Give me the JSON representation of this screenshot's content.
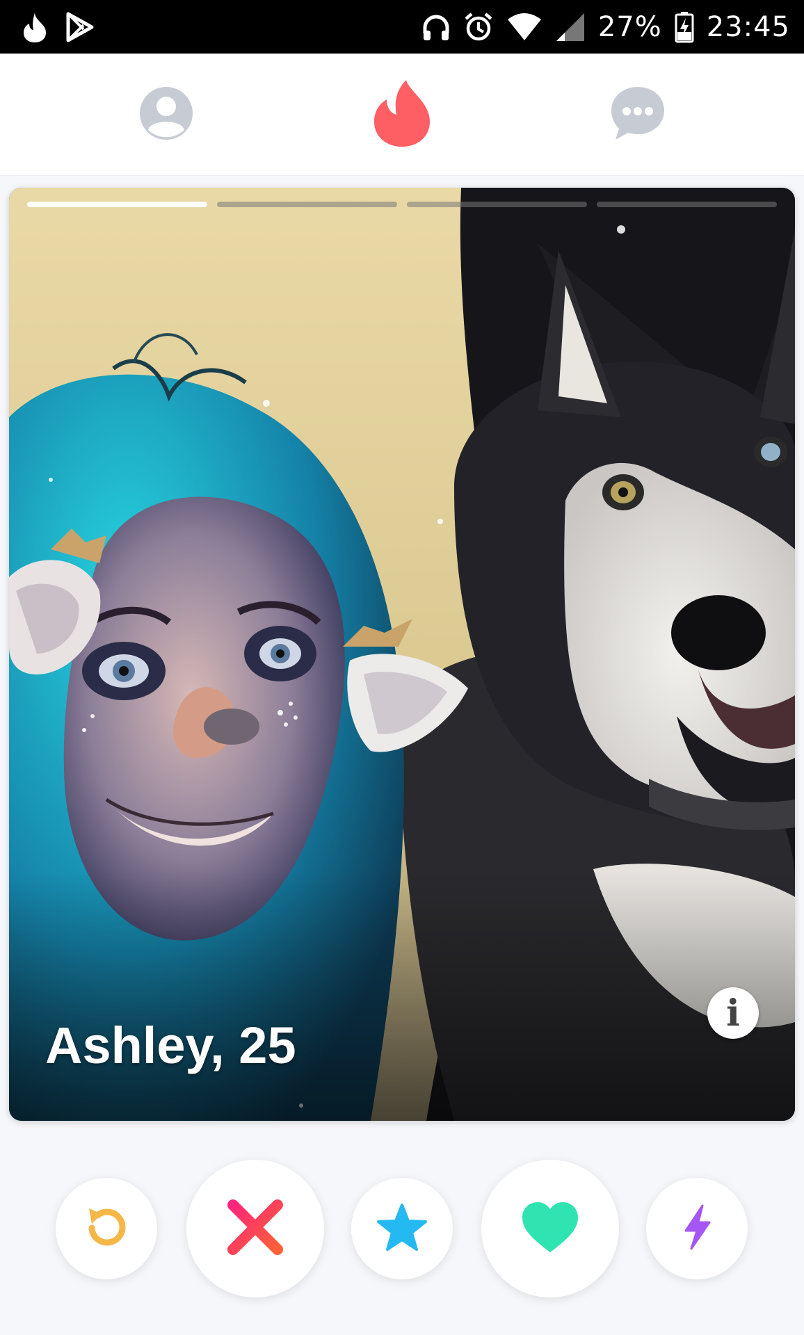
{
  "status_bar": {
    "left_icons": [
      "tinder-flame-icon",
      "play-store-icon"
    ],
    "right_icons": [
      "headphones-icon",
      "alarm-icon",
      "wifi-icon",
      "signal-icon",
      "battery-charging-icon"
    ],
    "battery": "27%",
    "time": "23:45"
  },
  "nav": {
    "items": [
      {
        "icon": "profile-icon",
        "color": "#c7cbd3"
      },
      {
        "icon": "flame-icon",
        "color": "#fe5f64",
        "active": true
      },
      {
        "icon": "messages-icon",
        "color": "#c7cbd3"
      }
    ]
  },
  "card": {
    "name_age": "Ashley, 25",
    "photo_count": 4,
    "current_photo": 1
  },
  "actions": [
    {
      "name": "rewind",
      "icon": "rewind-icon",
      "color": "#f5b748"
    },
    {
      "name": "nope",
      "icon": "close-icon",
      "color": "#fd5068"
    },
    {
      "name": "super-like",
      "icon": "star-icon",
      "color": "#25b9f2"
    },
    {
      "name": "like",
      "icon": "heart-icon",
      "color": "#2fe4b1"
    },
    {
      "name": "boost",
      "icon": "bolt-icon",
      "color": "#a656f4"
    }
  ],
  "colors": {
    "brand": "#fe5f64",
    "inactive_icon": "#c7cbd3",
    "background": "#f5f7fa"
  }
}
